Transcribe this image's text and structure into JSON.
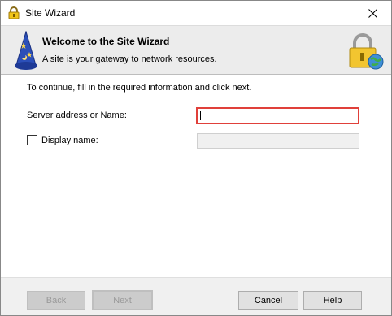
{
  "window": {
    "title": "Site Wizard"
  },
  "banner": {
    "title": "Welcome to the Site Wizard",
    "subtitle": "A site is your gateway to network resources."
  },
  "form": {
    "instruction": "To continue, fill in the required information and click next.",
    "server_label": "Server address or Name:",
    "server_value": "",
    "display_name_label": "Display name:",
    "display_name_checked": false,
    "display_name_value": ""
  },
  "buttons": {
    "back": "Back",
    "next": "Next",
    "cancel": "Cancel",
    "help": "Help"
  },
  "icons": {
    "title": "padlock-icon",
    "close": "close-icon",
    "banner_left": "wizard-hat-icon",
    "banner_right": "lock-globe-icon"
  },
  "colors": {
    "highlight": "#e0403a",
    "banner_bg": "#ececec",
    "footer_bg": "#f0f0f0"
  }
}
